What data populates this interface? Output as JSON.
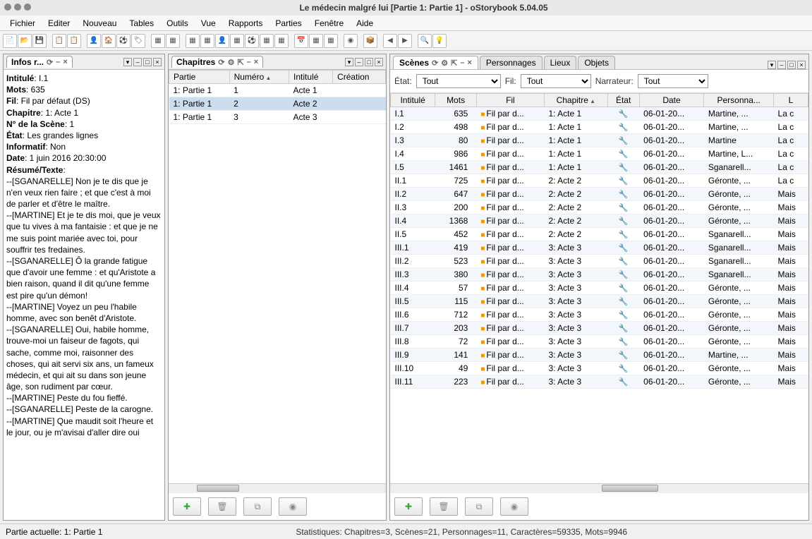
{
  "window": {
    "title": "Le médecin malgré lui [Partie 1: Partie 1] - oStorybook 5.04.05"
  },
  "menu": [
    "Fichier",
    "Editer",
    "Nouveau",
    "Tables",
    "Outils",
    "Vue",
    "Rapports",
    "Parties",
    "Fenêtre",
    "Aide"
  ],
  "info_panel": {
    "tab_label": "Infos r...",
    "intitule_label": "Intitulé",
    "intitule": "I.1",
    "mots_label": "Mots",
    "mots": "635",
    "fil_label": "Fil",
    "fil": "Fil par défaut (DS)",
    "chapitre_label": "Chapitre",
    "chapitre": "1: Acte 1",
    "numscene_label": "N° de la Scène",
    "numscene": "1",
    "etat_label": "État",
    "etat": "Les grandes lignes",
    "informatif_label": "Informatif",
    "informatif": "Non",
    "date_label": "Date",
    "date": "1 juin 2016 20:30:00",
    "resume_label": "Résumé/Texte",
    "body": "--[SGANARELLE] Non je te dis que je n'en veux rien faire ; et que c'est à moi de parler et d'être le maître.\n--[MARTINE] Et je te dis moi, que je veux que tu vives à ma fantaisie : et que je ne me suis point mariée avec toi, pour souffrir tes fredaines.\n--[SGANARELLE] Ô la grande fatigue que d'avoir une femme : et qu'Aristote a bien raison, quand il dit qu'une femme est pire qu'un démon!\n--[MARTINE] Voyez un peu l'habile homme, avec son benêt d'Aristote.\n--[SGANARELLE] Oui, habile homme, trouve-moi un faiseur de fagots, qui sache, comme moi, raisonner des choses, qui ait servi six ans, un fameux médecin, et qui ait su dans son jeune âge, son rudiment par cœur.\n--[MARTINE] Peste du fou fieffé.\n--[SGANARELLE] Peste de la carogne.\n--[MARTINE] Que maudit soit l'heure et le jour, ou je m'avisai d'aller dire oui"
  },
  "chapitres_panel": {
    "tab_label": "Chapitres",
    "columns": [
      "Partie",
      "Numéro",
      "Intitulé",
      "Création"
    ],
    "rows": [
      {
        "partie": "1: Partie 1",
        "numero": "1",
        "intitule": "Acte 1"
      },
      {
        "partie": "1: Partie 1",
        "numero": "2",
        "intitule": "Acte 2"
      },
      {
        "partie": "1: Partie 1",
        "numero": "3",
        "intitule": "Acte 3"
      }
    ],
    "selected_index": 1
  },
  "right_tabs": {
    "scenes": "Scènes",
    "personnages": "Personnages",
    "lieux": "Lieux",
    "objets": "Objets"
  },
  "filters": {
    "etat_label": "État:",
    "etat_value": "Tout",
    "fil_label": "Fil:",
    "fil_value": "Tout",
    "narr_label": "Narrateur:",
    "narr_value": "Tout"
  },
  "scenes_columns": [
    "Intitulé",
    "Mots",
    "Fil",
    "Chapitre",
    "État",
    "Date",
    "Personna...",
    "L"
  ],
  "scenes": [
    {
      "intitule": "I.1",
      "mots": "635",
      "fil": "Fil par d...",
      "chap": "1: Acte 1",
      "date": "06-01-20...",
      "pers": "Martine, ...",
      "loc": "La c"
    },
    {
      "intitule": "I.2",
      "mots": "498",
      "fil": "Fil par d...",
      "chap": "1: Acte 1",
      "date": "06-01-20...",
      "pers": "Martine, ...",
      "loc": "La c"
    },
    {
      "intitule": "I.3",
      "mots": "80",
      "fil": "Fil par d...",
      "chap": "1: Acte 1",
      "date": "06-01-20...",
      "pers": "Martine",
      "loc": "La c"
    },
    {
      "intitule": "I.4",
      "mots": "986",
      "fil": "Fil par d...",
      "chap": "1: Acte 1",
      "date": "06-01-20...",
      "pers": "Martine, L...",
      "loc": "La c"
    },
    {
      "intitule": "I.5",
      "mots": "1461",
      "fil": "Fil par d...",
      "chap": "1: Acte 1",
      "date": "06-01-20...",
      "pers": "Sganarell...",
      "loc": "La c"
    },
    {
      "intitule": "II.1",
      "mots": "725",
      "fil": "Fil par d...",
      "chap": "2: Acte 2",
      "date": "06-01-20...",
      "pers": "Géronte, ...",
      "loc": "La c"
    },
    {
      "intitule": "II.2",
      "mots": "647",
      "fil": "Fil par d...",
      "chap": "2: Acte 2",
      "date": "06-01-20...",
      "pers": "Géronte, ...",
      "loc": "Mais"
    },
    {
      "intitule": "II.3",
      "mots": "200",
      "fil": "Fil par d...",
      "chap": "2: Acte 2",
      "date": "06-01-20...",
      "pers": "Géronte, ...",
      "loc": "Mais"
    },
    {
      "intitule": "II.4",
      "mots": "1368",
      "fil": "Fil par d...",
      "chap": "2: Acte 2",
      "date": "06-01-20...",
      "pers": "Géronte, ...",
      "loc": "Mais"
    },
    {
      "intitule": "II.5",
      "mots": "452",
      "fil": "Fil par d...",
      "chap": "2: Acte 2",
      "date": "06-01-20...",
      "pers": "Sganarell...",
      "loc": "Mais"
    },
    {
      "intitule": "III.1",
      "mots": "419",
      "fil": "Fil par d...",
      "chap": "3: Acte 3",
      "date": "06-01-20...",
      "pers": "Sganarell...",
      "loc": "Mais"
    },
    {
      "intitule": "III.2",
      "mots": "523",
      "fil": "Fil par d...",
      "chap": "3: Acte 3",
      "date": "06-01-20...",
      "pers": "Sganarell...",
      "loc": "Mais"
    },
    {
      "intitule": "III.3",
      "mots": "380",
      "fil": "Fil par d...",
      "chap": "3: Acte 3",
      "date": "06-01-20...",
      "pers": "Sganarell...",
      "loc": "Mais"
    },
    {
      "intitule": "III.4",
      "mots": "57",
      "fil": "Fil par d...",
      "chap": "3: Acte 3",
      "date": "06-01-20...",
      "pers": "Géronte, ...",
      "loc": "Mais"
    },
    {
      "intitule": "III.5",
      "mots": "115",
      "fil": "Fil par d...",
      "chap": "3: Acte 3",
      "date": "06-01-20...",
      "pers": "Géronte, ...",
      "loc": "Mais"
    },
    {
      "intitule": "III.6",
      "mots": "712",
      "fil": "Fil par d...",
      "chap": "3: Acte 3",
      "date": "06-01-20...",
      "pers": "Géronte, ...",
      "loc": "Mais"
    },
    {
      "intitule": "III.7",
      "mots": "203",
      "fil": "Fil par d...",
      "chap": "3: Acte 3",
      "date": "06-01-20...",
      "pers": "Géronte, ...",
      "loc": "Mais"
    },
    {
      "intitule": "III.8",
      "mots": "72",
      "fil": "Fil par d...",
      "chap": "3: Acte 3",
      "date": "06-01-20...",
      "pers": "Géronte, ...",
      "loc": "Mais"
    },
    {
      "intitule": "III.9",
      "mots": "141",
      "fil": "Fil par d...",
      "chap": "3: Acte 3",
      "date": "06-01-20...",
      "pers": "Martine, ...",
      "loc": "Mais"
    },
    {
      "intitule": "III.10",
      "mots": "49",
      "fil": "Fil par d...",
      "chap": "3: Acte 3",
      "date": "06-01-20...",
      "pers": "Géronte, ...",
      "loc": "Mais"
    },
    {
      "intitule": "III.11",
      "mots": "223",
      "fil": "Fil par d...",
      "chap": "3: Acte 3",
      "date": "06-01-20...",
      "pers": "Géronte, ...",
      "loc": "Mais"
    }
  ],
  "statusbar": {
    "current_part": "Partie actuelle: 1: Partie 1",
    "stats": "Statistiques: Chapitres=3,  Scènes=21,  Personnages=11,  Caractères=59335,  Mots=9946"
  }
}
